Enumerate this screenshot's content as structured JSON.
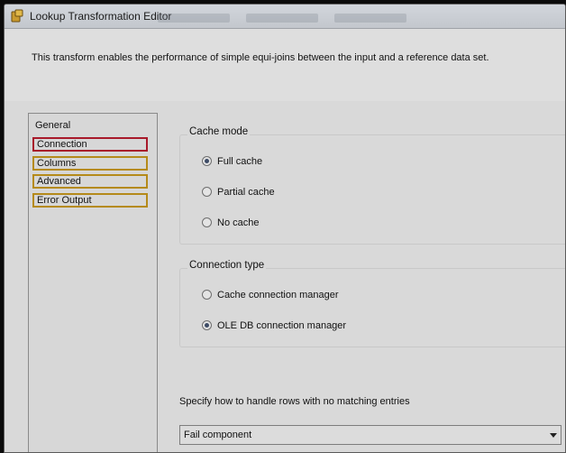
{
  "window": {
    "title": "Lookup Transformation Editor",
    "icon": "lookup-transform-icon"
  },
  "description": "This transform enables the performance of simple equi-joins between the input and a reference data set.",
  "nav": {
    "items": [
      {
        "label": "General",
        "highlight": "none"
      },
      {
        "label": "Connection",
        "highlight": "red"
      },
      {
        "label": "Columns",
        "highlight": "yellow"
      },
      {
        "label": "Advanced",
        "highlight": "yellow"
      },
      {
        "label": "Error Output",
        "highlight": "yellow"
      }
    ]
  },
  "cache_mode": {
    "label": "Cache mode",
    "options": [
      {
        "label": "Full cache",
        "checked": true
      },
      {
        "label": "Partial cache",
        "checked": false
      },
      {
        "label": "No cache",
        "checked": false
      }
    ]
  },
  "connection_type": {
    "label": "Connection type",
    "options": [
      {
        "label": "Cache connection manager",
        "checked": false
      },
      {
        "label": "OLE DB connection manager",
        "checked": true
      }
    ]
  },
  "no_match": {
    "label": "Specify how to handle rows with no matching entries",
    "selected": "Fail component"
  },
  "colors": {
    "highlight_red": "#a8192a",
    "highlight_yellow": "#b58a1a"
  }
}
